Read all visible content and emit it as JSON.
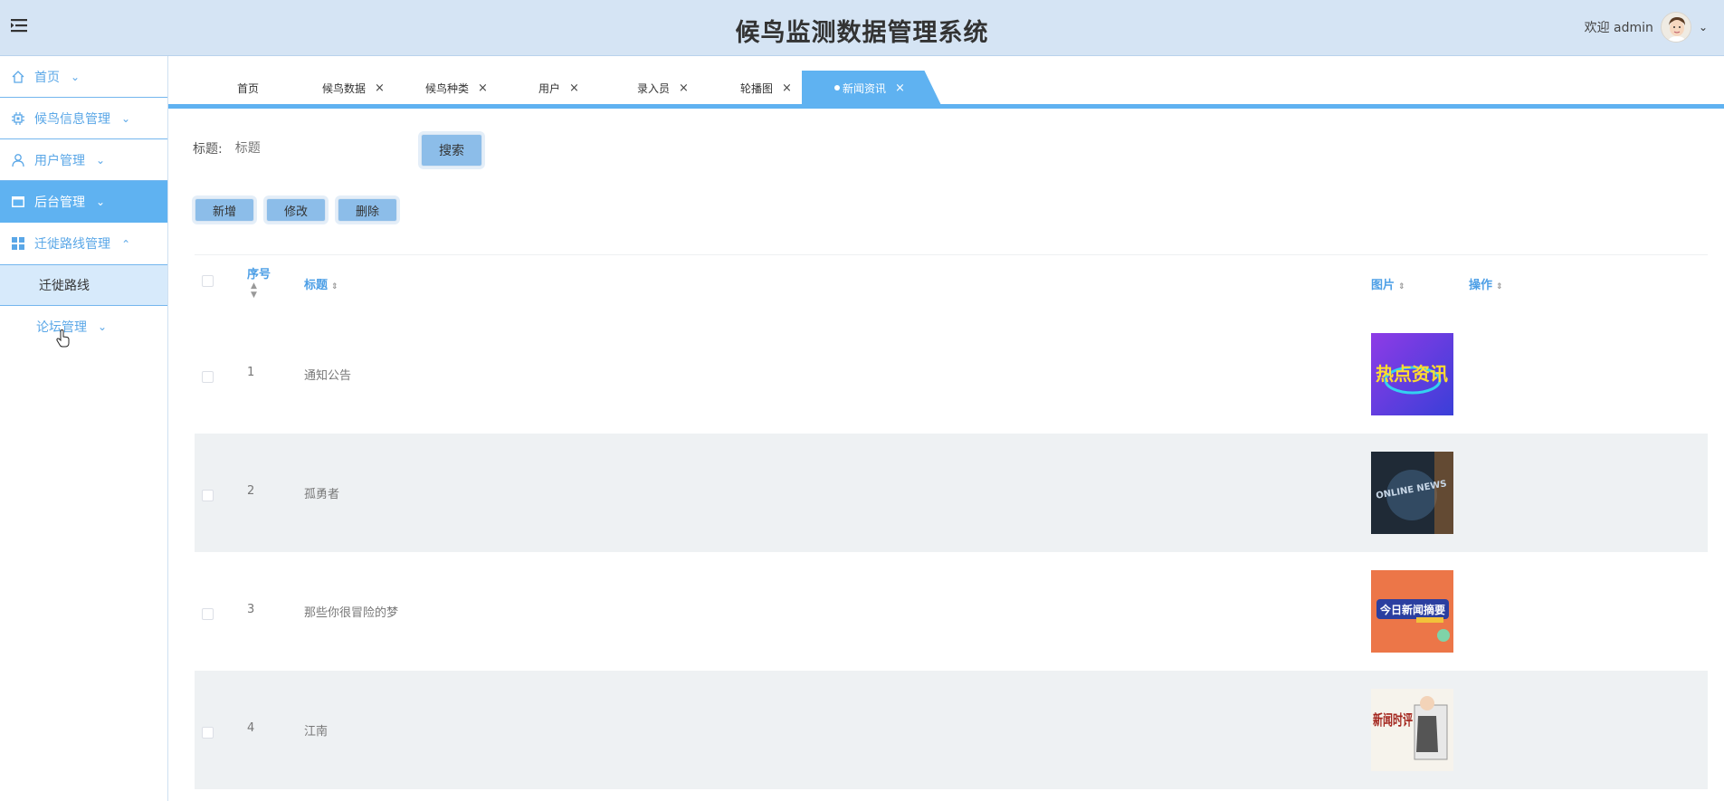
{
  "header": {
    "title": "候鸟监测数据管理系统",
    "welcome": "欢迎 admin"
  },
  "sidebar": {
    "items": [
      {
        "label": "首页",
        "icon": "home-icon"
      },
      {
        "label": "候鸟信息管理",
        "icon": "chip-icon"
      },
      {
        "label": "用户管理",
        "icon": "user-icon"
      },
      {
        "label": "后台管理",
        "icon": "window-icon",
        "active": true
      },
      {
        "label": "迁徙路线管理",
        "icon": "grid-icon",
        "expanded": true
      },
      {
        "label": "论坛管理"
      }
    ],
    "sub_items": [
      {
        "label": "迁徙路线"
      }
    ]
  },
  "tabs": [
    {
      "label": "首页",
      "closable": false
    },
    {
      "label": "候鸟数据",
      "closable": true
    },
    {
      "label": "候鸟种类",
      "closable": true
    },
    {
      "label": "用户",
      "closable": true
    },
    {
      "label": "录入员",
      "closable": true
    },
    {
      "label": "轮播图",
      "closable": true
    },
    {
      "label": "新闻资讯",
      "closable": true,
      "active": true
    }
  ],
  "close_glyph": "×",
  "search": {
    "label": "标题:",
    "placeholder": "标题",
    "button": "搜索"
  },
  "actions": {
    "add": "新增",
    "edit": "修改",
    "delete": "删除"
  },
  "table": {
    "columns": {
      "index": "序号",
      "title": "标题",
      "image": "图片",
      "operation": "操作"
    },
    "rows": [
      {
        "index": "1",
        "title": "通知公告",
        "image_text": "热点资讯"
      },
      {
        "index": "2",
        "title": "孤勇者",
        "image_text": "ONLINE NEWS"
      },
      {
        "index": "3",
        "title": "那些你很冒险的梦",
        "image_text": "今日新闻摘要"
      },
      {
        "index": "4",
        "title": "江南",
        "image_text": "新闻时评"
      }
    ]
  },
  "colors": {
    "header_bg": "#d5e4f4",
    "accent": "#5fb2f1",
    "button": "#8cbde9",
    "stripe": "#eef1f3"
  }
}
